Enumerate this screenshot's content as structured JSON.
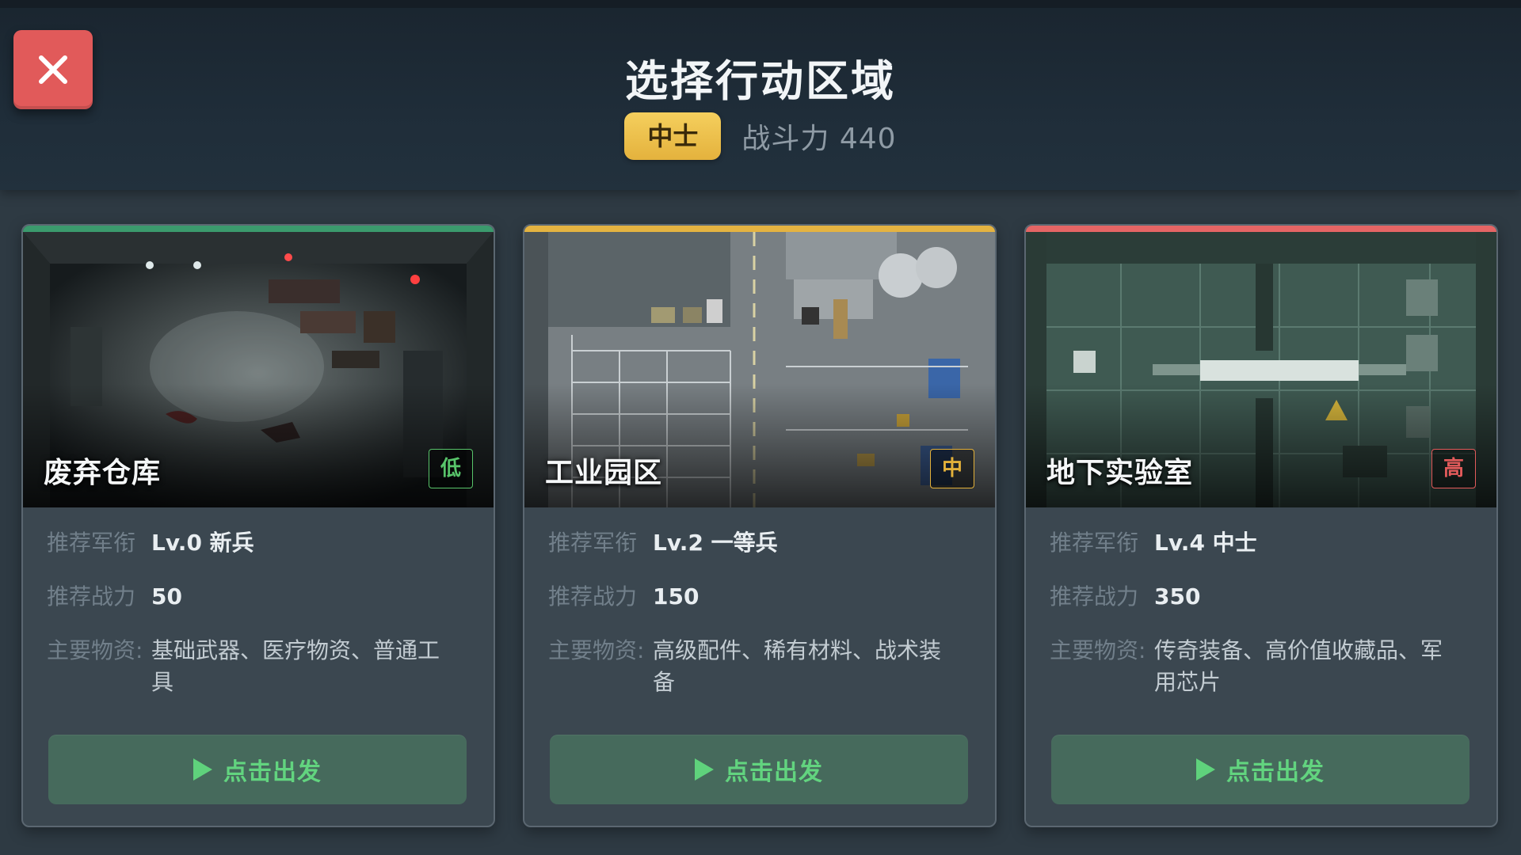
{
  "header": {
    "title": "选择行动区域",
    "rank": "中士",
    "power_text": "战斗力 440"
  },
  "close_icon": "close-icon",
  "zones": [
    {
      "name": "废弃仓库",
      "difficulty": "低",
      "accent": "#3b9a6d",
      "difficulty_color": "#58c46a",
      "rank_label": "推荐军衔",
      "rank_value": "Lv.0 新兵",
      "power_label": "推荐战力",
      "power_value": "50",
      "materials_label": "主要物资:",
      "materials_value": "基础武器、医疗物资、普通工具",
      "button": "点击出发"
    },
    {
      "name": "工业园区",
      "difficulty": "中",
      "accent": "#e4b341",
      "difficulty_color": "#e3b13a",
      "rank_label": "推荐军衔",
      "rank_value": "Lv.2 一等兵",
      "power_label": "推荐战力",
      "power_value": "150",
      "materials_label": "主要物资:",
      "materials_value": "高级配件、稀有材料、战术装备",
      "button": "点击出发"
    },
    {
      "name": "地下实验室",
      "difficulty": "高",
      "accent": "#e56565",
      "difficulty_color": "#e35b5b",
      "rank_label": "推荐军衔",
      "rank_value": "Lv.4 中士",
      "power_label": "推荐战力",
      "power_value": "350",
      "materials_label": "主要物资:",
      "materials_value": "传奇装备、高价值收藏品、军用芯片",
      "button": "点击出发"
    }
  ]
}
